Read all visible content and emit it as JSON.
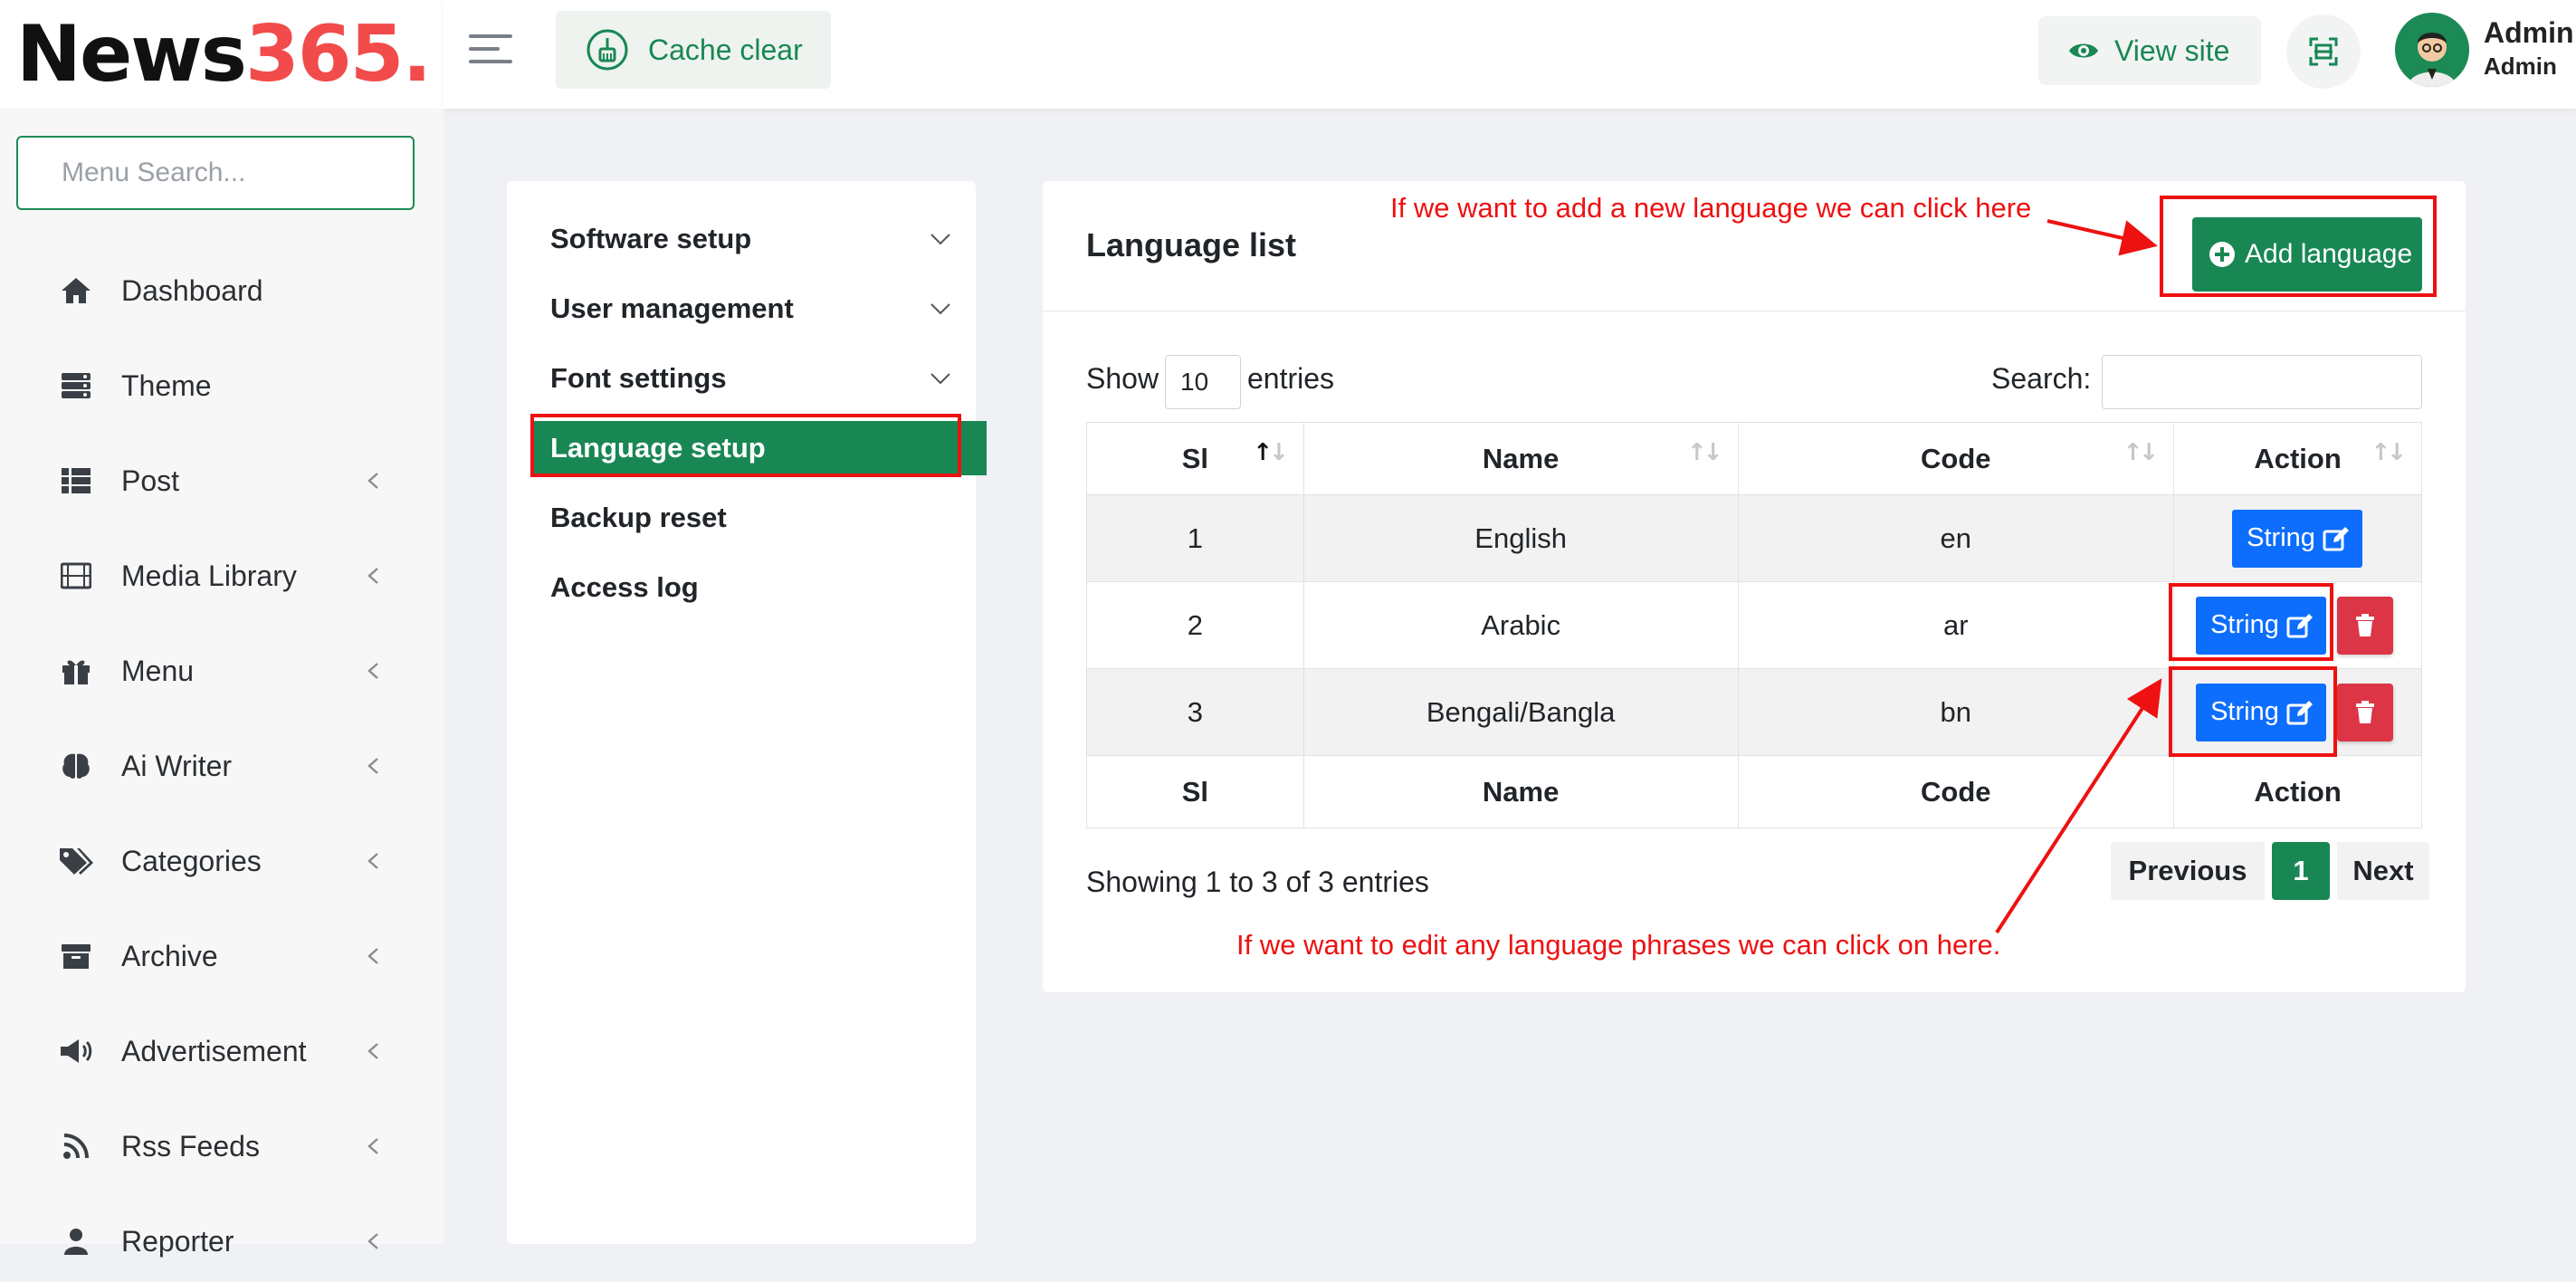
{
  "logo": {
    "part1": "News",
    "part2": "365."
  },
  "topbar": {
    "cache_label": "Cache clear",
    "view_site_label": "View site",
    "user_name": "Admin",
    "user_role": "Admin"
  },
  "sidebar": {
    "search_placeholder": "Menu Search...",
    "items": [
      {
        "label": "Dashboard",
        "icon": "home-icon",
        "has_submenu": false
      },
      {
        "label": "Theme",
        "icon": "theme-icon",
        "has_submenu": false
      },
      {
        "label": "Post",
        "icon": "list-icon",
        "has_submenu": true
      },
      {
        "label": "Media Library",
        "icon": "film-icon",
        "has_submenu": true
      },
      {
        "label": "Menu",
        "icon": "gift-icon",
        "has_submenu": true
      },
      {
        "label": "Ai Writer",
        "icon": "brain-icon",
        "has_submenu": true
      },
      {
        "label": "Categories",
        "icon": "tags-icon",
        "has_submenu": true
      },
      {
        "label": "Archive",
        "icon": "archive-icon",
        "has_submenu": true
      },
      {
        "label": "Advertisement",
        "icon": "megaphone-icon",
        "has_submenu": true
      },
      {
        "label": "Rss Feeds",
        "icon": "rss-icon",
        "has_submenu": true
      },
      {
        "label": "Reporter",
        "icon": "user-icon",
        "has_submenu": true
      }
    ]
  },
  "settings_menu": {
    "items": [
      {
        "label": "Software setup",
        "expandable": true
      },
      {
        "label": "User management",
        "expandable": true
      },
      {
        "label": "Font settings",
        "expandable": true
      },
      {
        "label": "Language setup",
        "expandable": false,
        "active": true
      },
      {
        "label": "Backup reset",
        "expandable": false
      },
      {
        "label": "Access log",
        "expandable": false
      }
    ]
  },
  "language_list": {
    "title": "Language list",
    "add_button": "Add language",
    "show_label": "Show",
    "entries_value": "10",
    "entries_label": "entries",
    "search_label": "Search:",
    "columns": [
      "Sl",
      "Name",
      "Code",
      "Action"
    ],
    "rows": [
      {
        "sl": "1",
        "name": "English",
        "code": "en",
        "deletable": false
      },
      {
        "sl": "2",
        "name": "Arabic",
        "code": "ar",
        "deletable": true
      },
      {
        "sl": "3",
        "name": "Bengali/Bangla",
        "code": "bn",
        "deletable": true
      }
    ],
    "string_button": "String",
    "showing_text": "Showing 1 to 3 of 3 entries",
    "pagination": {
      "previous": "Previous",
      "current_page": "1",
      "next": "Next"
    }
  },
  "annotations": {
    "add_note": "If we want to add a new language we can click here",
    "edit_note": "If we want to edit any language phrases we can click on here."
  },
  "colors": {
    "brand_green": "#188754",
    "logo_red": "#f24b4b",
    "primary_blue": "#0d6efd",
    "danger_red": "#dc3545",
    "annotation_red": "#ee1111"
  }
}
